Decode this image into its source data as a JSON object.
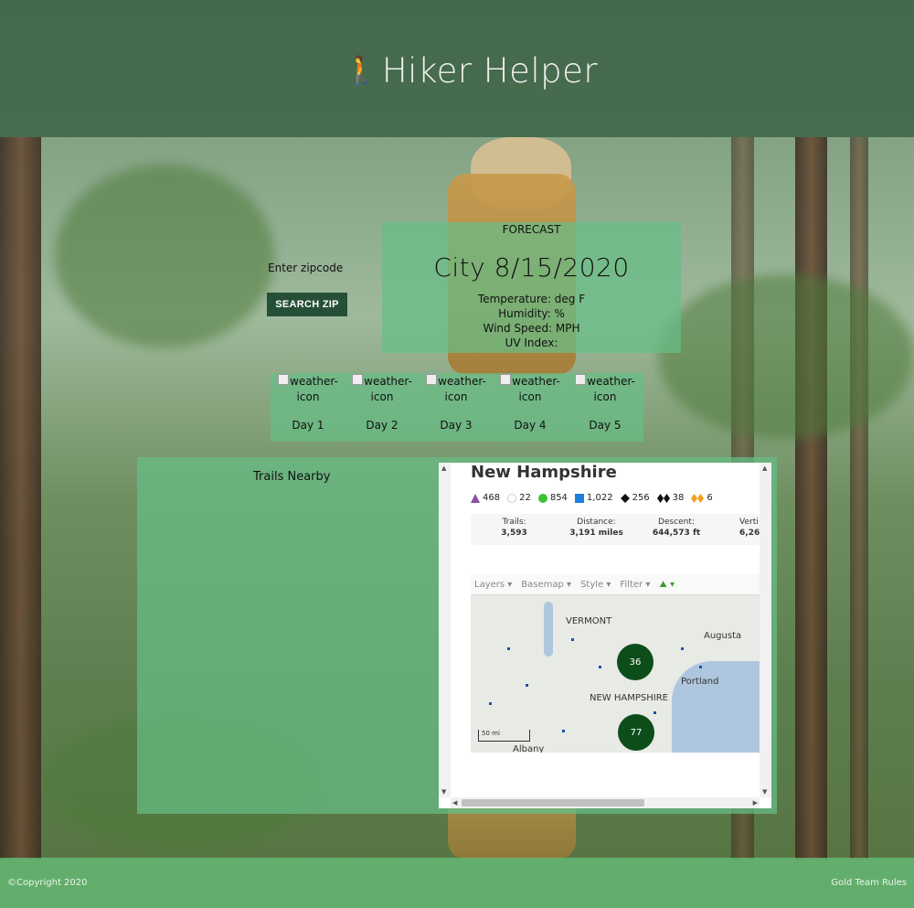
{
  "header": {
    "title": "Hiker Helper",
    "icon": "walking-person-icon"
  },
  "search": {
    "label": "Enter zipcode",
    "button": "SEARCH ZIP"
  },
  "forecast": {
    "label": "FORECAST",
    "city_date": "City 8/15/2020",
    "temperature": "Temperature: deg F",
    "humidity": "Humidity: %",
    "wind": "Wind Speed: MPH",
    "uv": "UV Index:"
  },
  "days": [
    {
      "alt": "weather-icon",
      "label": "Day 1"
    },
    {
      "alt": "weather-icon",
      "label": "Day 2"
    },
    {
      "alt": "weather-icon",
      "label": "Day 3"
    },
    {
      "alt": "weather-icon",
      "label": "Day 4"
    },
    {
      "alt": "weather-icon",
      "label": "Day 5"
    }
  ],
  "trails": {
    "title": "Trails Nearby",
    "state": "New Hampshire",
    "stats": [
      {
        "icon": "purple-triangle-icon",
        "color": "#8a4fa6",
        "value": "468"
      },
      {
        "icon": "white-circle-icon",
        "color": "#ffffff",
        "value": "22"
      },
      {
        "icon": "green-circle-icon",
        "color": "#39c23a",
        "value": "854"
      },
      {
        "icon": "blue-square-icon",
        "color": "#1f7fe0",
        "value": "1,022"
      },
      {
        "icon": "black-diamond-icon",
        "color": "#111111",
        "value": "256"
      },
      {
        "icon": "double-black-diamond-icon",
        "color": "#111111",
        "value": "38"
      },
      {
        "icon": "orange-double-diamond-icon",
        "color": "#f0a020",
        "value": "6"
      }
    ],
    "summary": [
      {
        "label": "Trails:",
        "value": "3,593"
      },
      {
        "label": "Distance:",
        "value": "3,191 miles"
      },
      {
        "label": "Descent:",
        "value": "644,573 ft"
      },
      {
        "label": "Verti",
        "value": "6,26"
      }
    ],
    "map": {
      "toolbar": [
        "Layers ▾",
        "Basemap ▾",
        "Style ▾",
        "Filter ▾"
      ],
      "labels": {
        "vermont": "VERMONT",
        "augusta": "Augusta",
        "portland": "Portland",
        "nh": "NEW HAMPSHIRE",
        "albany": "Albany"
      },
      "clusters": [
        "36",
        "77"
      ],
      "scale": "50 mi"
    }
  },
  "footer": {
    "copyright": "©Copyright 2020",
    "team": "Gold Team Rules"
  }
}
